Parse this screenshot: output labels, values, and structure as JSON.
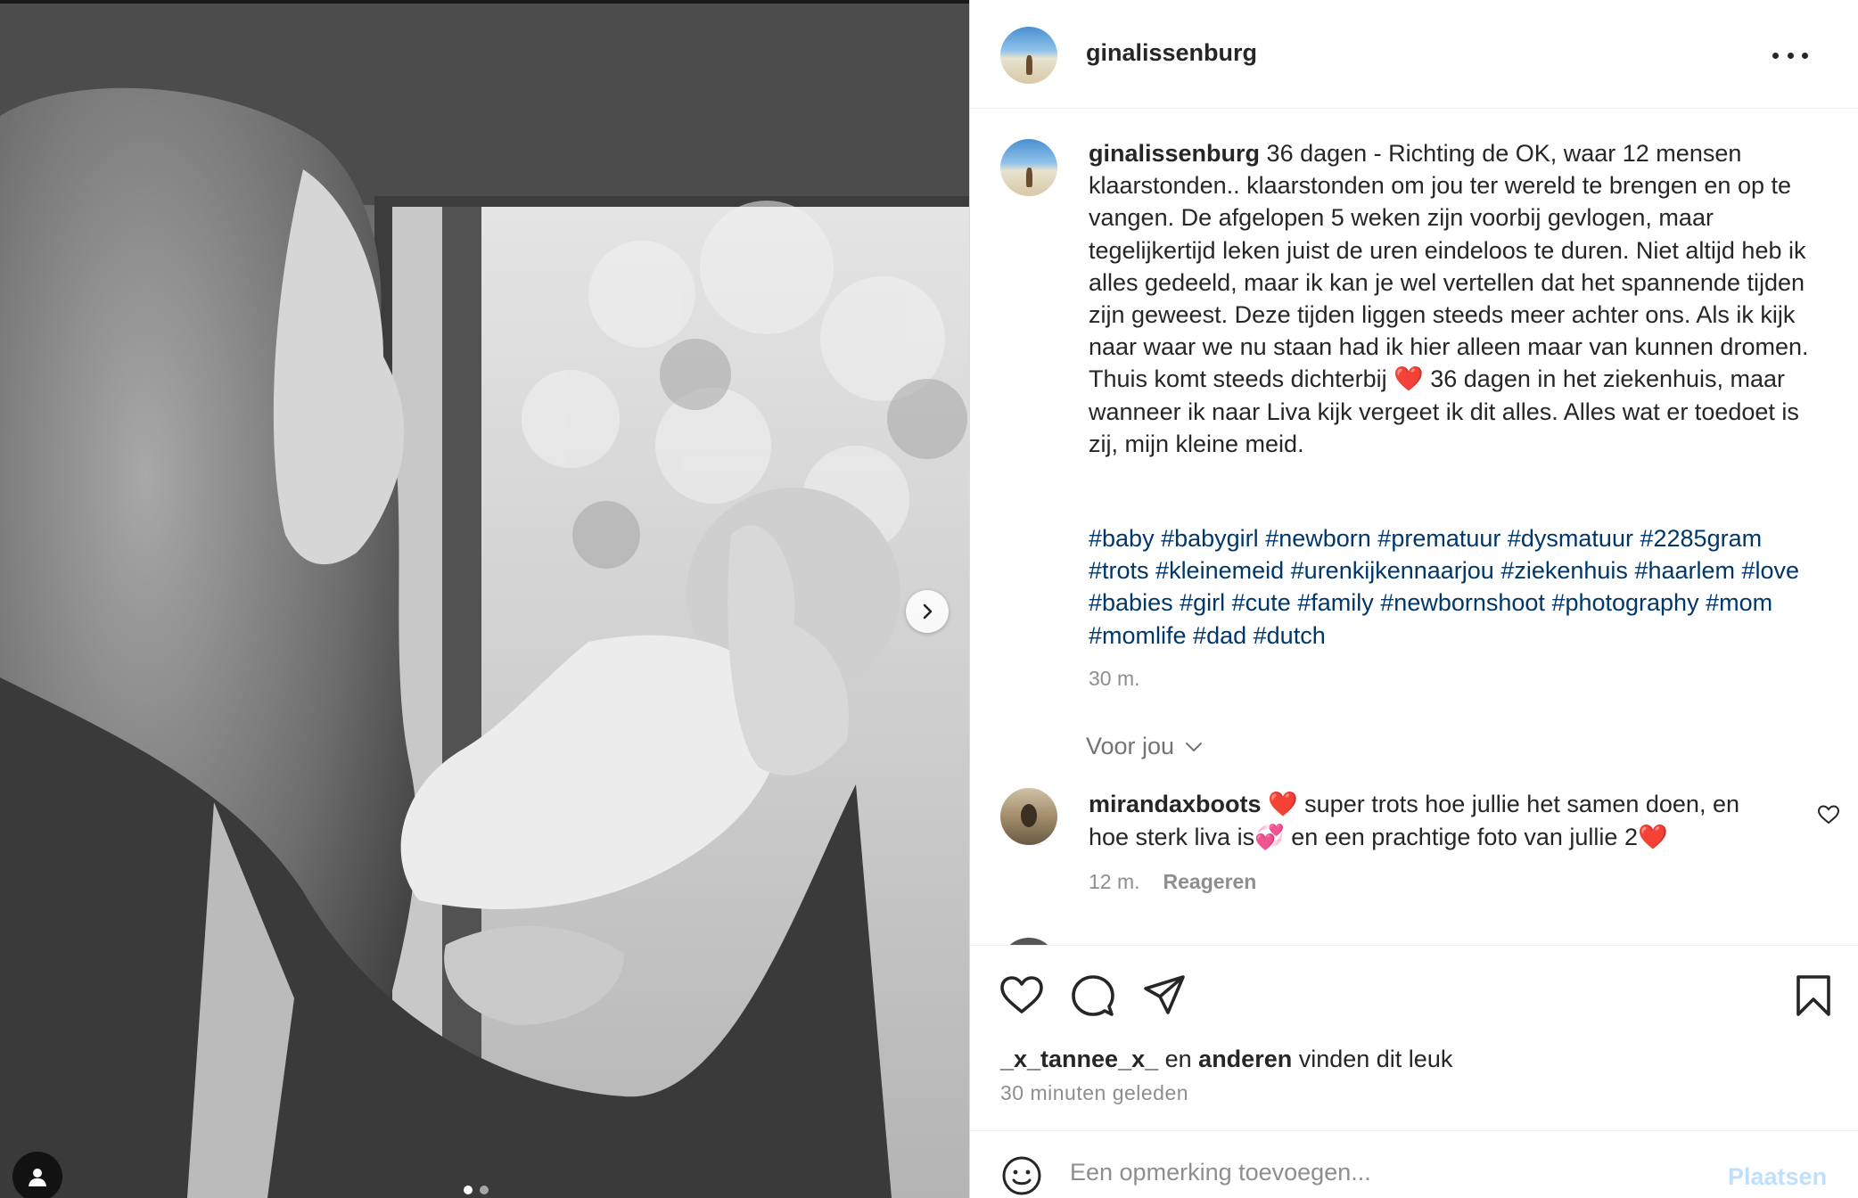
{
  "post": {
    "username": "ginalissenburg",
    "caption_text": " 36 dagen - Richting de OK, waar 12 mensen klaarstonden.. klaarstonden om jou ter wereld te brengen en op te vangen. De afgelopen 5 weken zijn voorbij gevlogen, maar tegelijkertijd leken juist de uren eindeloos te duren. Niet altijd heb ik alles gedeeld, maar ik kan je wel vertellen dat het spannende tijden zijn geweest. Deze tijden liggen steeds meer achter ons. Als ik kijk naar waar we nu staan had ik hier alleen maar van kunnen dromen. Thuis komt steeds dichterbij ❤️ 36 dagen in het ziekenhuis, maar wanneer ik naar Liva kijk vergeet ik dit alles. Alles wat er toedoet is zij, mijn kleine meid.",
    "hashtags": [
      "#baby",
      "#babygirl",
      "#newborn",
      "#prematuur",
      "#dysmatuur",
      "#2285gram",
      "#trots",
      "#kleinemeid",
      "#urenkijkennaarjou",
      "#ziekenhuis",
      "#haarlem",
      "#love",
      "#babies",
      "#girl",
      "#cute",
      "#family",
      "#newbornshoot",
      "#photography",
      "#mom",
      "#momlife",
      "#dad",
      "#dutch"
    ],
    "caption_time": "30 m."
  },
  "filter": {
    "label": "Voor jou"
  },
  "comment": {
    "username": "mirandaxboots",
    "text": " ❤️ super trots hoe jullie het samen doen, en hoe sterk liva is💞 en een prachtige foto van jullie 2❤️",
    "time": "12 m.",
    "reply_label": "Reageren"
  },
  "likes": {
    "first_user": "_x_tannee_x_",
    "connector": " en ",
    "others": "anderen",
    "suffix": " vinden dit leuk"
  },
  "posted_ago": "30 MINUTEN GELEDEN",
  "posted_ago_display": "30 minuten geleden",
  "add_comment": {
    "placeholder": "Een opmerking toevoegen...",
    "post_label": "Plaatsen"
  },
  "carousel": {
    "slides": 2,
    "current": 1
  },
  "colors": {
    "hashtag": "#00376b",
    "post_button_disabled": "#c0dffd",
    "muted": "#8e8e8e"
  },
  "icons": [
    "more-icon",
    "heart-icon",
    "comment-icon",
    "share-icon",
    "bookmark-icon",
    "emoji-icon",
    "chevron-right-icon",
    "chevron-down-icon",
    "user-tag-icon"
  ]
}
